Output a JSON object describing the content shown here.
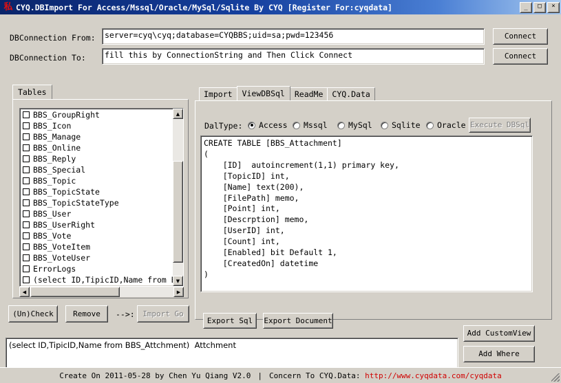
{
  "window": {
    "title": "CYQ.DBImport For Access/Mssql/Oracle/MySql/Sqlite By CYQ [Register For:cyqdata]",
    "icon": "app-icon",
    "minimize": "_",
    "maximize": "□",
    "close": "×"
  },
  "connection": {
    "from_label": "DBConnection From:",
    "from_value": "server=cyq\\cyq;database=CYQBBS;uid=sa;pwd=123456",
    "to_label": "DBConnection To:",
    "to_value": "fill this by ConnectionString and Then Click Connect",
    "connect_from_button": "Connect",
    "connect_to_button": "Connect"
  },
  "left_panel": {
    "tab_label": "Tables",
    "items": [
      "BBS_GroupRight",
      "BBS_Icon",
      "BBS_Manage",
      "BBS_Online",
      "BBS_Reply",
      "BBS_Special",
      "BBS_Topic",
      "BBS_TopicState",
      "BBS_TopicStateType",
      "BBS_User",
      "BBS_UserRight",
      "BBS_Vote",
      "BBS_VoteItem",
      "BBS_VoteUser",
      "ErrorLogs",
      "(select ID,TipicID,Name from BBS_Att"
    ],
    "buttons": {
      "uncheck": "(Un)Check",
      "remove": "Remove",
      "arrow_label": "-->:",
      "import_go": "Import Go"
    }
  },
  "right_panel": {
    "tabs": [
      {
        "label": "Import",
        "active": false
      },
      {
        "label": "ViewDBSql",
        "active": true
      },
      {
        "label": "ReadMe",
        "active": false
      },
      {
        "label": "CYQ.Data",
        "active": false
      }
    ],
    "daltype_label": "DalType:",
    "daltype_options": [
      {
        "label": "Access",
        "selected": true
      },
      {
        "label": "Mssql",
        "selected": false
      },
      {
        "label": "MySql",
        "selected": false
      },
      {
        "label": "Sqlite",
        "selected": false
      },
      {
        "label": "Oracle",
        "selected": false
      }
    ],
    "execute_button": "Execute DBSql",
    "sql_text": "CREATE TABLE [BBS_Attachment]\n(\n    [ID]  autoincrement(1,1) primary key,\n    [TopicID] int,\n    [Name] text(200),\n    [FilePath] memo,\n    [Point] int,\n    [Descrption] memo,\n    [UserID] int,\n    [Count] int,\n    [Enabled] bit Default 1,\n    [CreatedOn] datetime\n)",
    "export_sql_button": "Export Sql",
    "export_document_button": "Export Document"
  },
  "bottom": {
    "custom_view_text": "(select ID,TipicID,Name from BBS_Attchment)  Attchment",
    "add_customview_button": "Add CustomView",
    "add_where_button": "Add Where"
  },
  "statusbar": {
    "created": "Create On 2011-05-28 by Chen Yu Qiang V2.0",
    "separator": "|",
    "concern": "Concern To CYQ.Data:",
    "link": "http://www.cyqdata.com/cyqdata"
  },
  "colors": {
    "titlebar_start": "#0a246a",
    "titlebar_end": "#a6c8ef",
    "window_bg": "#d4d0c8",
    "link": "#d00000",
    "icon": "#e01010"
  }
}
